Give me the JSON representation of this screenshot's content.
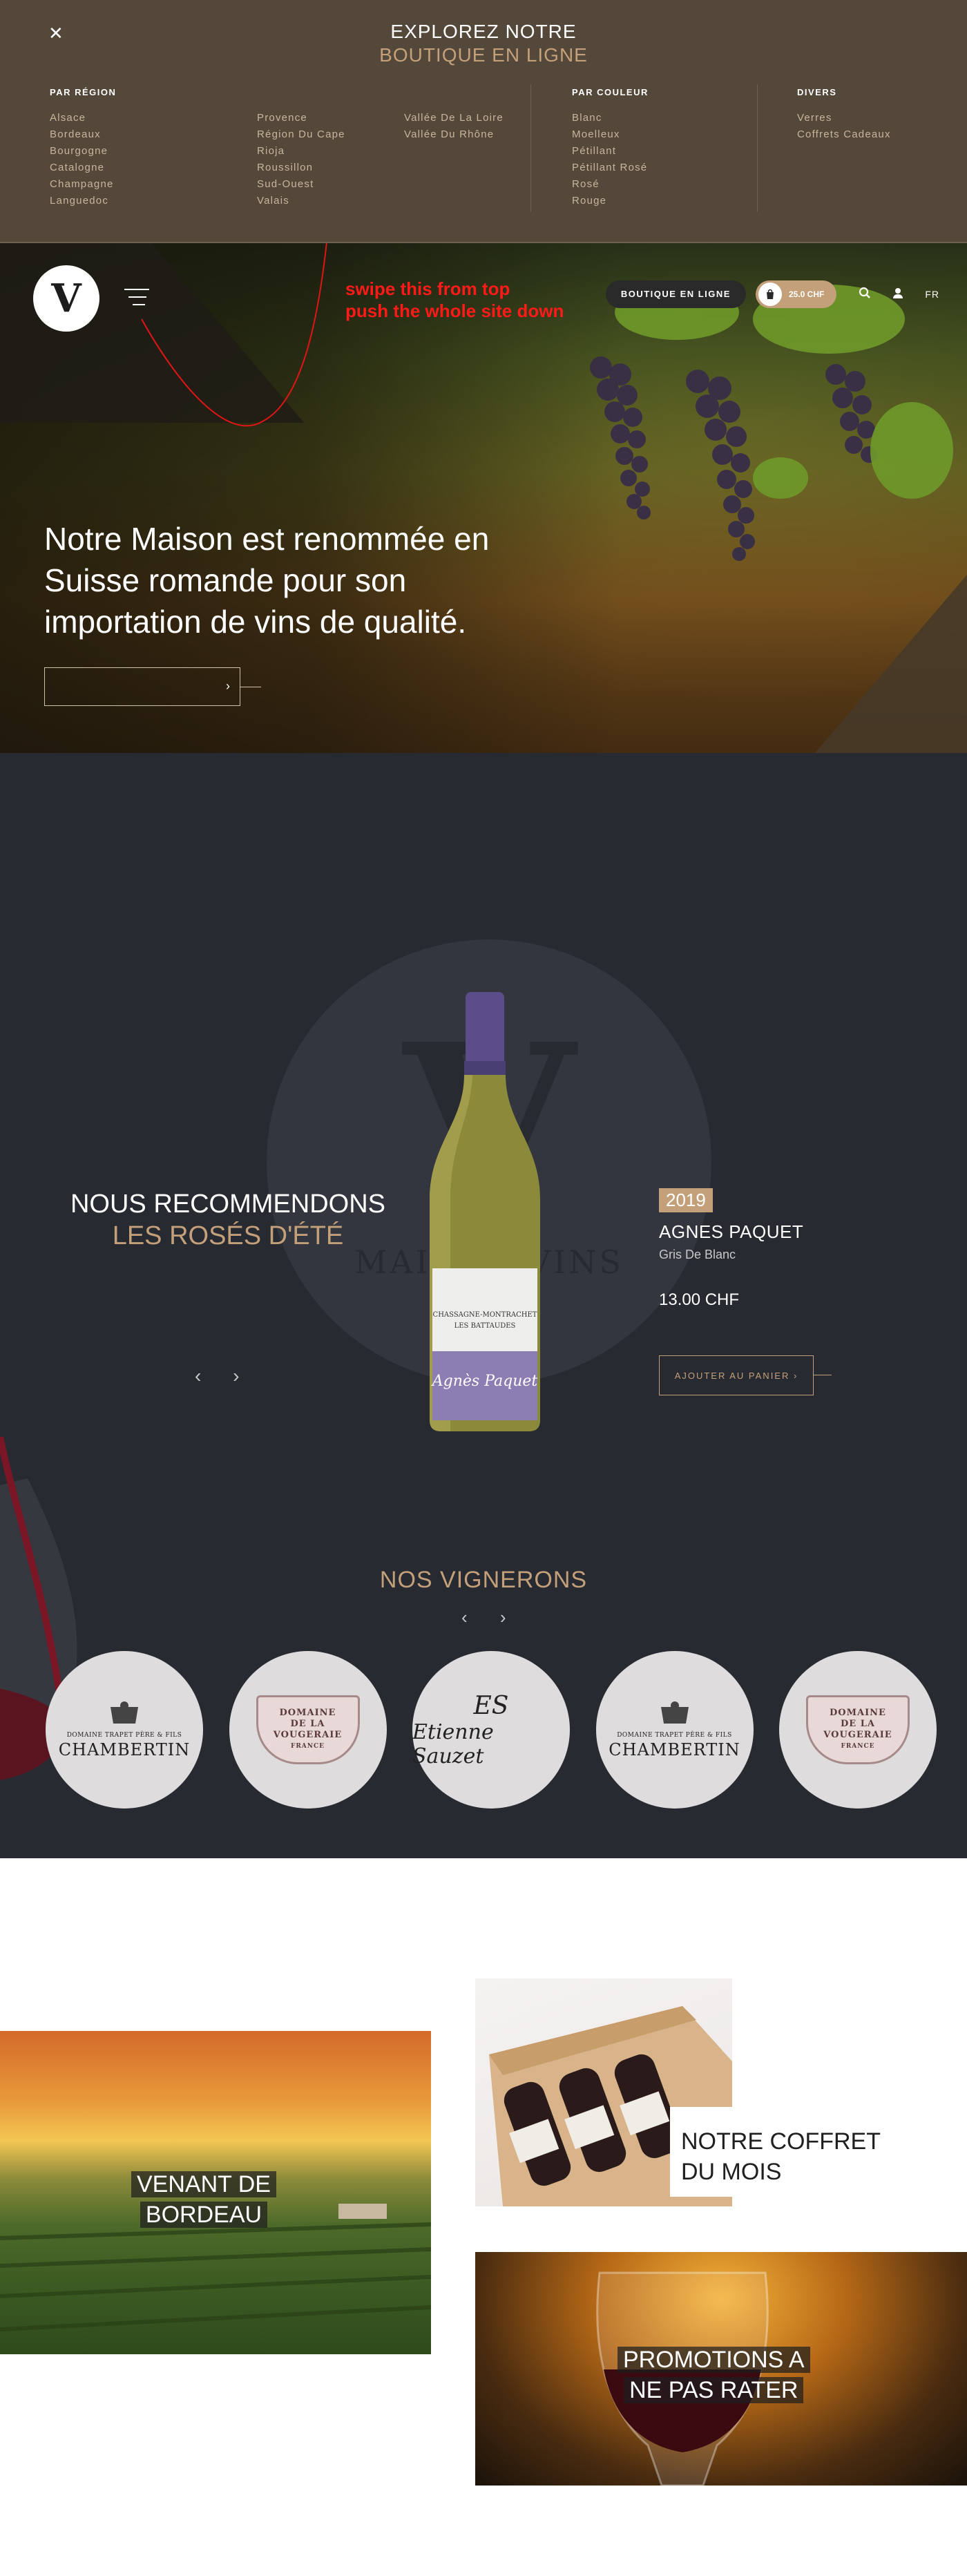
{
  "menu": {
    "close_icon": "close-icon",
    "title_line1": "EXPLOREZ NOTRE",
    "title_line2": "BOUTIQUE EN LIGNE",
    "region_heading": "PAR RÉGION",
    "region_col1": [
      "Alsace",
      "Bordeaux",
      "Bourgogne",
      "Catalogne",
      "Champagne",
      "Languedoc"
    ],
    "region_col2": [
      "Provence",
      "Région Du Cape",
      "Rioja",
      "Roussillon",
      "Sud-Ouest",
      "Valais"
    ],
    "region_col3": [
      "Vallée De La Loire",
      "Vallée Du Rhône"
    ],
    "color_heading": "PAR COULEUR",
    "color_items": [
      "Blanc",
      "Moelleux",
      "Pétillant",
      "Pétillant Rosé",
      "Rosé",
      "Rouge"
    ],
    "misc_heading": "DIVERS",
    "misc_items": [
      "Verres",
      "Coffrets Cadeaux"
    ]
  },
  "header": {
    "logo_letter": "V",
    "shop_label": "BOUTIQUE EN LIGNE",
    "cart_amount": "25.0 CHF",
    "lang": "FR",
    "annotation_line1": "swipe this from top",
    "annotation_line2": "push the whole site down"
  },
  "hero": {
    "headline": "Notre Maison est renommée en Suisse romande pour son importation de vins de qualité.",
    "cta_chevron": "›"
  },
  "recommend": {
    "title_line1": "NOUS RECOMMENDONS",
    "title_line2": "LES ROSÉS D'ÉTÉ",
    "watermark_letter": "V",
    "watermark_text": "MAISON VINS",
    "prev": "‹",
    "next": "›",
    "year": "2019",
    "producer": "AGNES PAQUET",
    "wine": "Gris De Blanc",
    "price": "13.00 CHF",
    "add_to_cart": "AJOUTER AU PANIER  ›",
    "bottle_label_line1": "CHASSAGNE-MONTRACHET",
    "bottle_label_line2": "LES BATTAUDES",
    "bottle_script": "Agnès Paquet"
  },
  "vignerons": {
    "title": "NOS VIGNERONS",
    "prev": "‹",
    "next": "›",
    "items": [
      {
        "small": "DOMAINE TRAPET PÈRE & FILS",
        "name": "CHAMBERTIN"
      },
      {
        "line1": "DOMAINE",
        "line2": "DE LA",
        "line3": "VOUGERAIE",
        "line4": "FRANCE"
      },
      {
        "monogram": "ES",
        "name": "Etienne Sauzet"
      },
      {
        "small": "DOMAINE TRAPET PÈRE & FILS",
        "name": "CHAMBERTIN"
      },
      {
        "line1": "DOMAINE",
        "line2": "DE LA",
        "line3": "VOUGERAIE",
        "line4": "FRANCE"
      }
    ]
  },
  "tiles": {
    "bordeaux_line1": "VENANT DE",
    "bordeaux_line2": "BORDEAU",
    "coffret_line1": "NOTRE COFFRET",
    "coffret_line2": "DU MOIS",
    "promo_line1": "PROMOTIONS A",
    "promo_line2": "NE PAS RATER"
  },
  "colors": {
    "menu_bg": "#54483a",
    "accent_gold": "#c3a07a",
    "dark_bg": "#272a31",
    "annotation_red": "#ff1a1a"
  }
}
